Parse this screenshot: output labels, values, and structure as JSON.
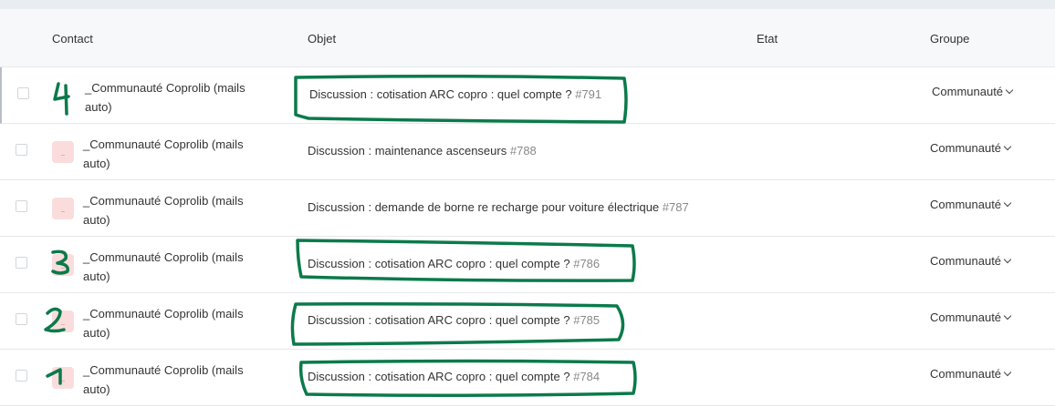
{
  "columns": {
    "contact": "Contact",
    "objet": "Objet",
    "etat": "Etat",
    "groupe": "Groupe"
  },
  "rows": [
    {
      "contact": "_Communauté Coprolib (mails auto)",
      "subject": "Discussion : cotisation ARC copro : quel compte ?",
      "number": "#791",
      "group": "Communauté",
      "annotation": "4"
    },
    {
      "contact": "_Communauté Coprolib (mails auto)",
      "subject": "Discussion : maintenance ascenseurs",
      "number": "#788",
      "group": "Communauté",
      "annotation": ""
    },
    {
      "contact": "_Communauté Coprolib (mails auto)",
      "subject": "Discussion : demande de borne re recharge pour voiture électrique",
      "number": "#787",
      "group": "Communauté",
      "annotation": ""
    },
    {
      "contact": "_Communauté Coprolib (mails auto)",
      "subject": "Discussion : cotisation ARC copro : quel compte ?",
      "number": "#786",
      "group": "Communauté",
      "annotation": "3"
    },
    {
      "contact": "_Communauté Coprolib (mails auto)",
      "subject": "Discussion : cotisation ARC copro : quel compte ?",
      "number": "#785",
      "group": "Communauté",
      "annotation": "2"
    },
    {
      "contact": "_Communauté Coprolib (mails auto)",
      "subject": "Discussion : cotisation ARC copro : quel compte ?",
      "number": "#784",
      "group": "Communauté",
      "annotation": "1"
    }
  ],
  "colors": {
    "annotation": "#0b7a4b",
    "header_bg": "#f7f8fa",
    "avatar_bg": "#fbdcdc"
  }
}
